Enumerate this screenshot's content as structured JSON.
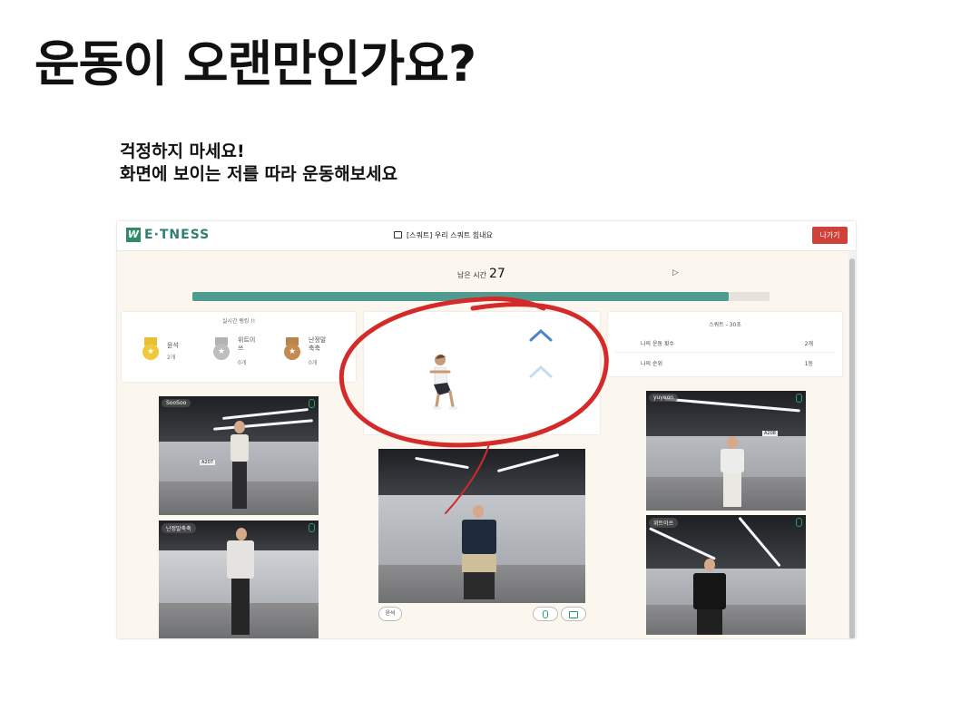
{
  "slide": {
    "title": "운동이 오랜만인가요?",
    "subtitle_line1": "걱정하지 마세요!",
    "subtitle_line2": "화면에 보이는 저를 따라 운동해보세요"
  },
  "app": {
    "logo_mark": "W",
    "logo_text": "E·TNESS",
    "room_title": "[스쿼트] 우리 스쿼트 힘내요",
    "exit_label": "나가기",
    "timer_label": "남은 시간",
    "timer_value": "27",
    "progress": 0.93,
    "colors": {
      "brand": "#2e8b64",
      "progress": "#4f9b8f",
      "exit": "#d0413a",
      "annotation": "#d42a2a"
    }
  },
  "ranking": {
    "title": "실시간 랭킹 !!",
    "entries": [
      {
        "name": "윤석",
        "count": "2개",
        "medal": "gold-medal-icon"
      },
      {
        "name_line1": "위트이",
        "name_line2": "쓰",
        "count": "0개",
        "medal": "silver-medal-icon"
      },
      {
        "name_line1": "난정말",
        "name_line2": "축축",
        "count": "0개",
        "medal": "bronze-medal-icon"
      }
    ]
  },
  "stats": {
    "title": "스쿼트 - 30초",
    "rows": [
      {
        "label": "나의 운동 횟수",
        "value": "2개"
      },
      {
        "label": "나의 순위",
        "value": "1등"
      }
    ]
  },
  "videos": {
    "left_top": "SooSoo",
    "left_bottom": "난정말축축",
    "right_top": "yuyeon",
    "right_bottom": "위트이쓰",
    "center_name": "윤석"
  },
  "room_signs": {
    "a": "A207",
    "b": "A208"
  }
}
